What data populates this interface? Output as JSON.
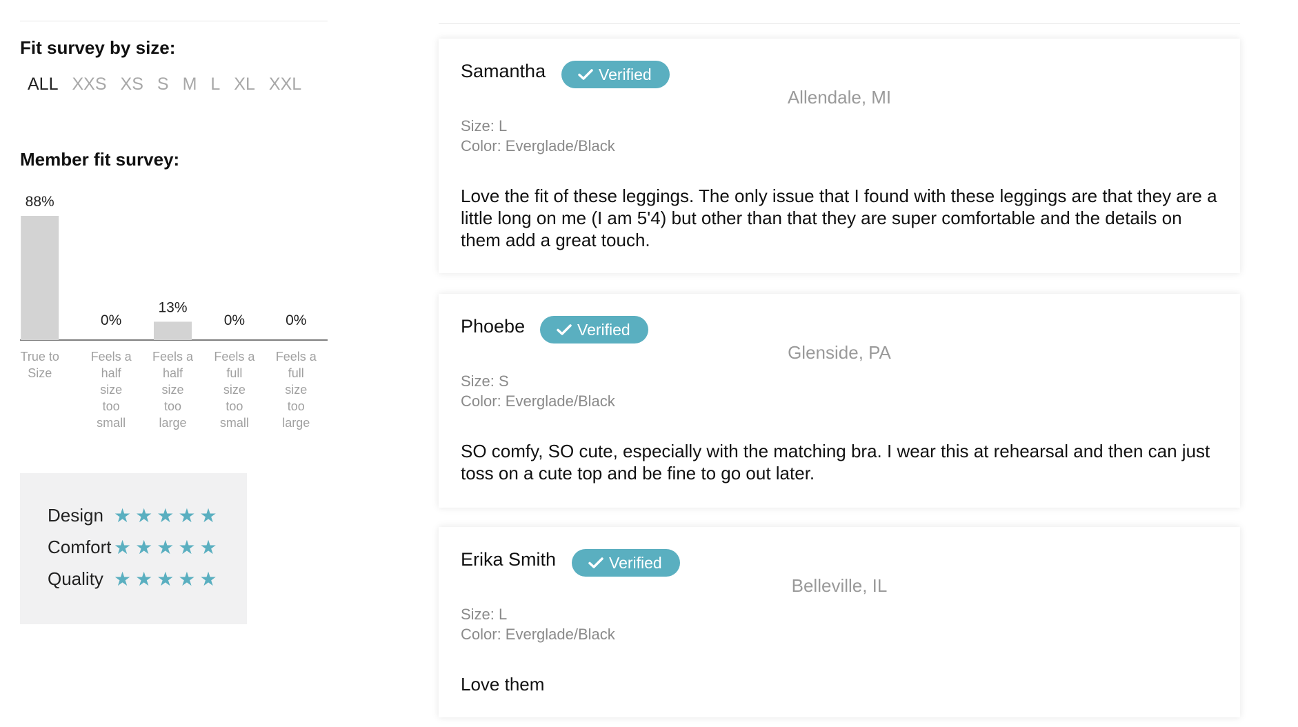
{
  "fit_survey": {
    "title": "Fit survey by size:",
    "sizes": [
      "ALL",
      "XXS",
      "XS",
      "S",
      "M",
      "L",
      "XL",
      "XXL"
    ],
    "active_size": "ALL"
  },
  "member_survey": {
    "title": "Member fit survey:"
  },
  "chart_data": {
    "type": "bar",
    "categories": [
      [
        "True to",
        "Size"
      ],
      [
        "Feels a",
        "half",
        "size",
        "too",
        "small"
      ],
      [
        "Feels a",
        "half",
        "size",
        "too",
        "large"
      ],
      [
        "Feels a",
        "full",
        "size",
        "too",
        "small"
      ],
      [
        "Feels a",
        "full",
        "size",
        "too",
        "large"
      ]
    ],
    "values": [
      88,
      0,
      13,
      0,
      0
    ],
    "labels": [
      "88%",
      "0%",
      "13%",
      "0%",
      "0%"
    ],
    "ylim": [
      0,
      88
    ],
    "bar_color": "#d3d3d3"
  },
  "ratings": [
    {
      "label": "Design",
      "stars": 5
    },
    {
      "label": "Comfort",
      "stars": 5
    },
    {
      "label": "Quality",
      "stars": 5
    }
  ],
  "star_color": "#5aafc0",
  "reviews": [
    {
      "name": "Samantha",
      "badge": "Verified",
      "location": "Allendale, MI",
      "size": "Size: L",
      "color": "Color: Everglade/Black",
      "text": "Love the fit of these leggings. The only issue that I found with these leggings are that they are a little long on me (I am 5'4) but other than that they are super comfortable and the details on them add a great touch."
    },
    {
      "name": "Phoebe",
      "badge": "Verified",
      "location": "Glenside, PA",
      "size": "Size: S",
      "color": "Color: Everglade/Black",
      "text": "SO comfy, SO cute, especially with the matching bra. I wear this at rehearsal and then can just toss on a cute top and be fine to go out later."
    },
    {
      "name": "Erika Smith",
      "badge": "Verified",
      "location": "Belleville, IL",
      "size": "Size: L",
      "color": "Color: Everglade/Black",
      "text": "Love them"
    }
  ],
  "badge_color": "#5aafc0"
}
